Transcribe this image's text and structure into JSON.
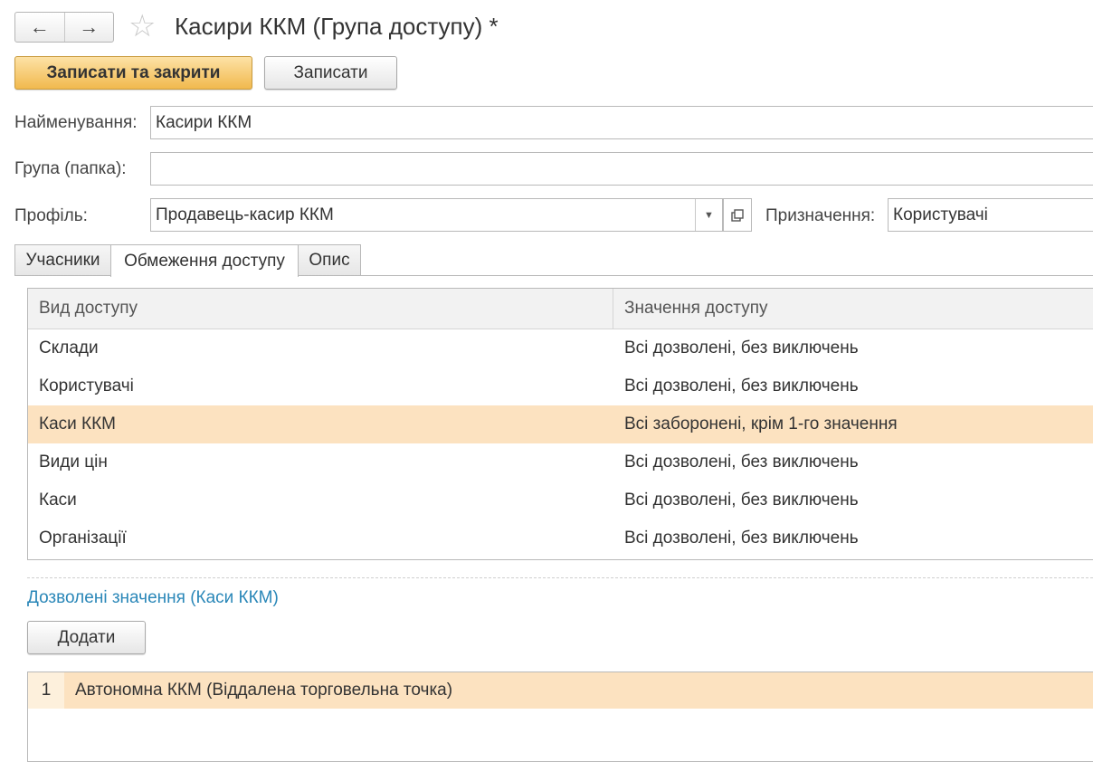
{
  "window": {
    "title": "Касири ККМ (Група доступу) *",
    "back_icon": "←",
    "forward_icon": "→",
    "star_icon": "☆"
  },
  "toolbar": {
    "save_close_label": "Записати та закрити",
    "save_label": "Записати"
  },
  "form": {
    "name_label": "Найменування:",
    "name_value": "Касири ККМ",
    "group_label": "Група (папка):",
    "group_value": "",
    "profile_label": "Профіль:",
    "profile_value": "Продавець-касир ККМ",
    "purpose_label": "Призначення:",
    "purpose_value": "Користувачі"
  },
  "tabs": [
    {
      "label": "Учасники"
    },
    {
      "label": "Обмеження доступу"
    },
    {
      "label": "Опис"
    }
  ],
  "access_table": {
    "headers": [
      "Вид доступу",
      "Значення доступу"
    ],
    "rows": [
      {
        "kind": "Склади",
        "value": "Всі дозволені, без виключень"
      },
      {
        "kind": "Користувачі",
        "value": "Всі дозволені, без виключень"
      },
      {
        "kind": "Каси ККМ",
        "value": "Всі заборонені, крім 1-го значення"
      },
      {
        "kind": "Види цін",
        "value": "Всі дозволені, без виключень"
      },
      {
        "kind": "Каси",
        "value": "Всі дозволені, без виключень"
      },
      {
        "kind": "Організації",
        "value": "Всі дозволені, без виключень"
      }
    ]
  },
  "allowed": {
    "title": "Дозволені значення (Каси ККМ)",
    "add_label": "Додати",
    "rows": [
      {
        "num": "1",
        "text": "Автономна ККМ (Віддалена торговельна точка)"
      }
    ]
  },
  "colors": {
    "accent": "#f1b94e",
    "selected_row": "#fce2c0",
    "link": "#2a87b8"
  }
}
